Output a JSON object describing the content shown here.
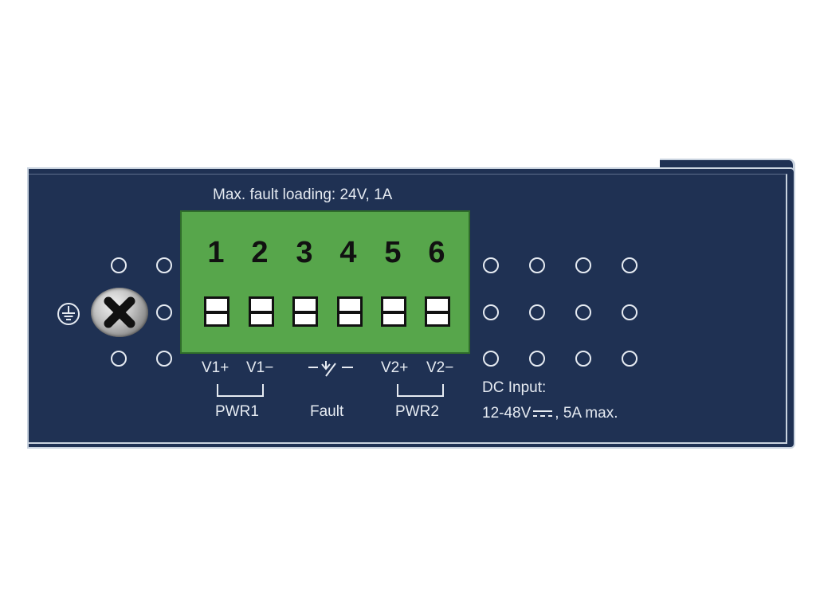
{
  "header_text": "Max. fault loading: 24V, 1A",
  "pins": [
    "1",
    "2",
    "3",
    "4",
    "5",
    "6"
  ],
  "labels": {
    "v1_plus": "V1+",
    "v1_minus": "V1−",
    "v2_plus": "V2+",
    "v2_minus": "V2−",
    "pwr1": "PWR1",
    "fault": "Fault",
    "pwr2": "PWR2"
  },
  "dc_input": {
    "line1": "DC Input:",
    "line2_pre": "12-48V",
    "line2_post": ", 5A max."
  },
  "icons": [
    "ground-icon",
    "screw-icon",
    "fault-relay-icon",
    "dc-symbol-icon"
  ],
  "colors": {
    "panel": "#1f3153",
    "terminal": "#57a64b",
    "text": "#e6ebf2"
  }
}
